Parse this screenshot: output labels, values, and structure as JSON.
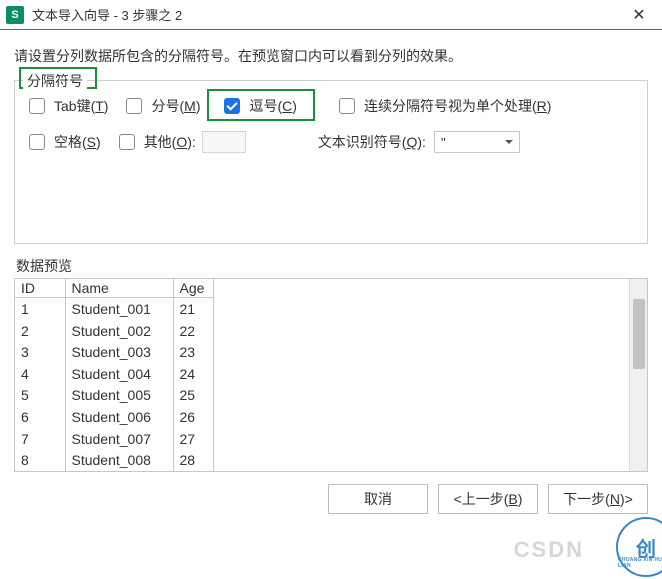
{
  "titlebar": {
    "app_icon": "S",
    "title": "文本导入向导 - 3 步骤之 2",
    "close": "✕"
  },
  "instruction": "请设置分列数据所包含的分隔符号。在预览窗口内可以看到分列的效果。",
  "delimiters": {
    "legend": "分隔符号",
    "tab": {
      "label_pre": "Tab键(",
      "hot": "T",
      "label_post": ")",
      "checked": false
    },
    "semicolon": {
      "label_pre": "分号(",
      "hot": "M",
      "label_post": ")",
      "checked": false
    },
    "comma": {
      "label_pre": "逗号(",
      "hot": "C",
      "label_post": ")",
      "checked": true
    },
    "consecutive": {
      "label_pre": "连续分隔符号视为单个处理(",
      "hot": "R",
      "label_post": ")",
      "checked": false
    },
    "space": {
      "label_pre": "空格(",
      "hot": "S",
      "label_post": ")",
      "checked": false
    },
    "other": {
      "label_pre": "其他(",
      "hot": "O",
      "label_post": "):",
      "checked": false,
      "value": ""
    },
    "qualifier": {
      "label_pre": "文本识别符号(",
      "hot": "Q",
      "label_post": "):",
      "value": "\""
    }
  },
  "preview": {
    "label": "数据预览",
    "columns": [
      "ID",
      "Name",
      "Age"
    ],
    "rows": [
      [
        "1",
        "Student_001",
        "21"
      ],
      [
        "2",
        "Student_002",
        "22"
      ],
      [
        "3",
        "Student_003",
        "23"
      ],
      [
        "4",
        "Student_004",
        "24"
      ],
      [
        "5",
        "Student_005",
        "25"
      ],
      [
        "6",
        "Student_006",
        "26"
      ],
      [
        "7",
        "Student_007",
        "27"
      ],
      [
        "8",
        "Student_008",
        "28"
      ]
    ]
  },
  "buttons": {
    "cancel": "取消",
    "back_pre": "<上一步(",
    "back_hot": "B",
    "back_post": ")",
    "next_pre": "下一步(",
    "next_hot": "N",
    "next_post": ")>"
  },
  "watermark": {
    "text": "CSDN",
    "logo": "创",
    "sub": "CHUANG XIN HU LIAN"
  }
}
